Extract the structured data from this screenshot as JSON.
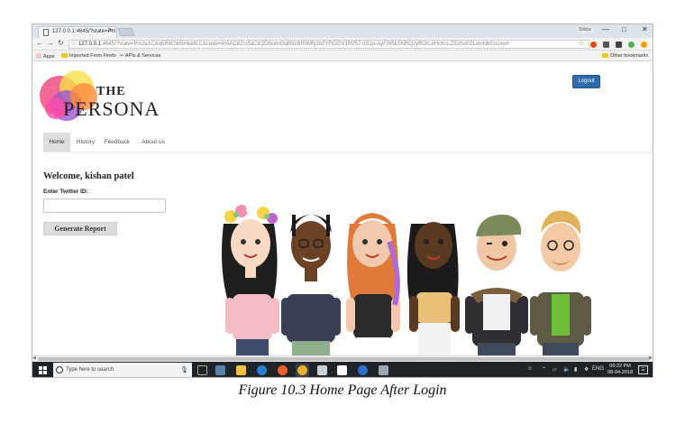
{
  "browser": {
    "tab_title": "127.0.0.1:4645/?state=Pm",
    "tab_close": "×",
    "profile_name": "Shilpa",
    "window_controls": [
      "—",
      "□",
      "✕"
    ],
    "nav_icons": [
      "back-arrow",
      "forward-arrow",
      "reload"
    ],
    "url_host": "127.0.0.1",
    "url_rest": ":4645/?state=Pm3x1CXu5RbCW5Hke8LC&code=4/AAC82cr5aCkQD8cent3q8NzBR0MfyzhZYRGGV1R057-uS1p-AyFW5kXNRQzyROrLbHcKcLZEo5oPZLwnNbGzcvw#",
    "bookmarks": {
      "apps": "Apps",
      "imported": "Imported From Firefo",
      "apis": "APIs & Services",
      "other": "Other bookmarks"
    },
    "extension_colors": [
      "#e64a19",
      "#555555",
      "#444444",
      "#4caf50",
      "#f4a000"
    ]
  },
  "site": {
    "logo_the": "THE",
    "logo_persona": "PERSONA",
    "logout_label": "Logout",
    "nav": [
      {
        "label": "Home",
        "active": true
      },
      {
        "label": "History",
        "active": false
      },
      {
        "label": "Feedback",
        "active": false
      },
      {
        "label": "About us",
        "active": false
      }
    ],
    "welcome": "Welcome, kishan patel",
    "twitter_label": "Enter Twitter ID:",
    "twitter_value": "",
    "generate_label": "Generate Report",
    "accent": "#2f6bab"
  },
  "taskbar": {
    "search_placeholder": "Type here to search",
    "tray_lang": "ENG",
    "time": "06:22 PM",
    "date": "08-04-2018"
  },
  "caption": "Figure 10.3 Home Page After Login"
}
